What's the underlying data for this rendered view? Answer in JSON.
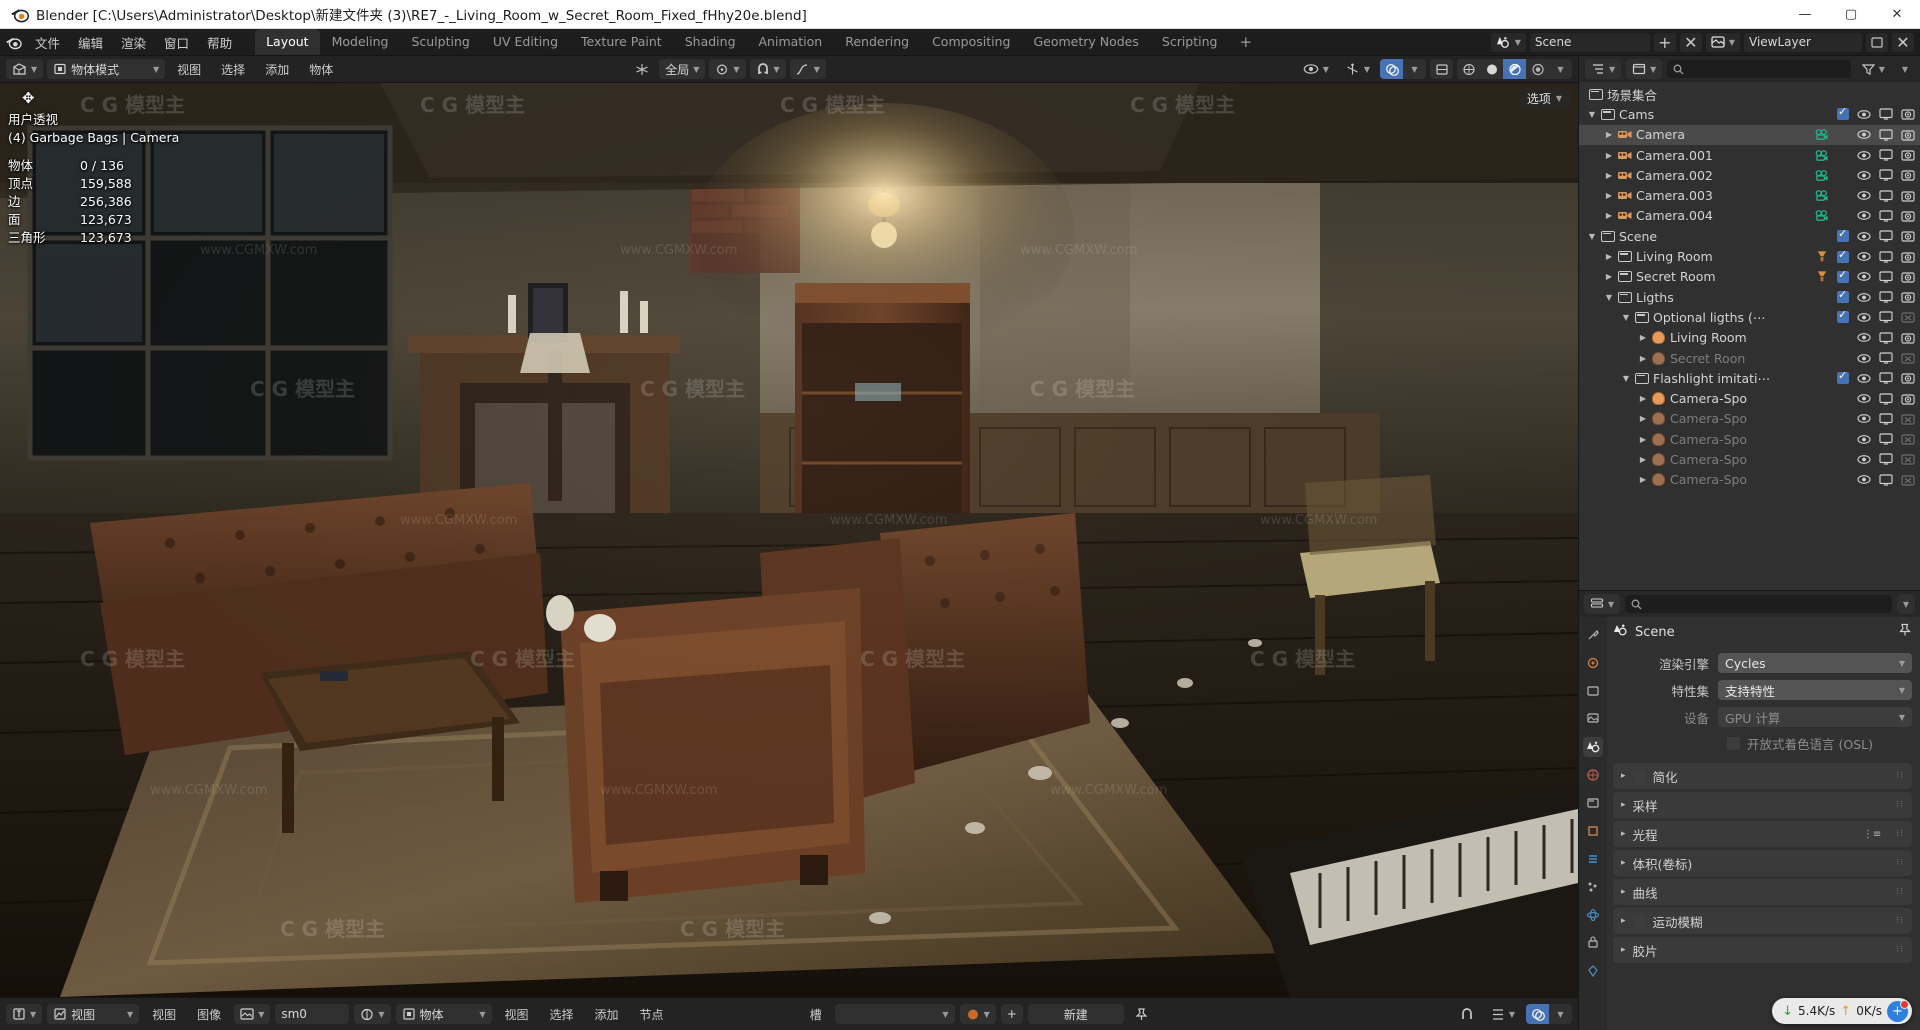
{
  "window": {
    "title": "Blender [C:\\Users\\Administrator\\Desktop\\新建文件夹 (3)\\RE7_-_Living_Room_w_Secret_Room_Fixed_fHhy20e.blend]",
    "minimize": "—",
    "maximize": "▢",
    "close": "✕"
  },
  "topbar": {
    "menus": [
      "文件",
      "编辑",
      "渲染",
      "窗口",
      "帮助"
    ],
    "workspaces": [
      "Layout",
      "Modeling",
      "Sculpting",
      "UV Editing",
      "Texture Paint",
      "Shading",
      "Animation",
      "Rendering",
      "Compositing",
      "Geometry Nodes",
      "Scripting"
    ],
    "active_workspace": "Layout",
    "add_workspace": "+",
    "scene_name": "Scene",
    "viewlayer_name": "ViewLayer",
    "scene_icon": "scene-icon",
    "viewlayer_icon": "viewlayer-icon"
  },
  "viewport_header": {
    "editor_type_icon": "editor-type-3dview-icon",
    "mode": "物体模式",
    "menus": [
      "视图",
      "选择",
      "添加",
      "物体"
    ],
    "transform_orientation": "全局",
    "snap_icon": "magnet-icon",
    "proportional_icon": "proportional-edit-icon",
    "pivot_icon": "pivot-icon",
    "visibility_icon": "eye-icon",
    "gizmo_icon": "gizmo-icon",
    "overlay_icon": "overlays-icon",
    "xray_icon": "xray-icon",
    "shading_modes": [
      "wireframe",
      "solid",
      "material-preview",
      "rendered"
    ],
    "active_shading": "rendered"
  },
  "viewport": {
    "cursor_icon": "move-cursor-icon",
    "view_name": "用户透视",
    "active_object": "(4) Garbage Bags | Camera",
    "stats": [
      {
        "label": "物体",
        "value": "0 / 136"
      },
      {
        "label": "顶点",
        "value": "159,588"
      },
      {
        "label": "边",
        "value": "256,386"
      },
      {
        "label": "面",
        "value": "123,673"
      },
      {
        "label": "三角形",
        "value": "123,673"
      }
    ],
    "options_label": "选项",
    "watermarks": [
      "CG模型主",
      "www.CGMXW.com"
    ]
  },
  "viewport_footer": {
    "left_editor_icon": "uv-editor-icon",
    "left_items": [
      "视图",
      "视图",
      "图像"
    ],
    "image_datablock_icon": "image-icon",
    "image_name": "sm0",
    "node_editor_icon": "node-editor-icon",
    "node_context": "物体",
    "node_menus": [
      "视图",
      "选择",
      "添加",
      "节点"
    ],
    "slot_label": "槽",
    "material_icon": "material-icon",
    "new_button": "新建",
    "pin_icon": "pin-icon",
    "snap_icon": "snap-icon",
    "overlay_icon": "overlay-icon"
  },
  "outliner": {
    "display_mode_icon": "outliner-display-mode-icon",
    "search_placeholder": "",
    "filter_icon": "filter-icon",
    "root": "场景集合",
    "rows": [
      {
        "indent": 0,
        "tri": "▼",
        "icon": "collection-icon",
        "name": "Cams",
        "checkbox": true,
        "eye": true,
        "screen": true,
        "camera": true,
        "dim": false,
        "datatype": ""
      },
      {
        "indent": 1,
        "tri": "▶",
        "icon": "camera-data-icon",
        "name": "Camera",
        "checkbox": null,
        "eye": true,
        "screen": true,
        "camera": true,
        "dim": false,
        "datatype": "camera-green",
        "selected": true
      },
      {
        "indent": 1,
        "tri": "▶",
        "icon": "camera-data-icon",
        "name": "Camera.001",
        "checkbox": null,
        "eye": true,
        "screen": true,
        "camera": true,
        "dim": false,
        "datatype": "camera-green"
      },
      {
        "indent": 1,
        "tri": "▶",
        "icon": "camera-data-icon",
        "name": "Camera.002",
        "checkbox": null,
        "eye": true,
        "screen": true,
        "camera": true,
        "dim": false,
        "datatype": "camera-green"
      },
      {
        "indent": 1,
        "tri": "▶",
        "icon": "camera-data-icon",
        "name": "Camera.003",
        "checkbox": null,
        "eye": true,
        "screen": true,
        "camera": true,
        "dim": false,
        "datatype": "camera-green"
      },
      {
        "indent": 1,
        "tri": "▶",
        "icon": "camera-data-icon",
        "name": "Camera.004",
        "checkbox": null,
        "eye": true,
        "screen": true,
        "camera": true,
        "dim": false,
        "datatype": "camera-green"
      },
      {
        "indent": 0,
        "tri": "▼",
        "icon": "collection-icon",
        "name": "Scene",
        "checkbox": true,
        "eye": true,
        "screen": true,
        "camera": true,
        "dim": false,
        "datatype": ""
      },
      {
        "indent": 1,
        "tri": "▶",
        "icon": "collection-icon",
        "name": "Living Room",
        "checkbox": true,
        "eye": true,
        "screen": true,
        "camera": true,
        "dim": false,
        "datatype": "light-count"
      },
      {
        "indent": 1,
        "tri": "▶",
        "icon": "collection-icon",
        "name": "Secret Room",
        "checkbox": true,
        "eye": true,
        "screen": true,
        "camera": true,
        "dim": false,
        "datatype": "light-count"
      },
      {
        "indent": 1,
        "tri": "▼",
        "icon": "collection-icon",
        "name": "Ligths",
        "checkbox": true,
        "eye": true,
        "screen": true,
        "camera": true,
        "dim": false,
        "datatype": ""
      },
      {
        "indent": 2,
        "tri": "▼",
        "icon": "collection-icon",
        "name": "Optional ligths (⋯",
        "checkbox": true,
        "eye": true,
        "screen": true,
        "camera": false,
        "dim": false,
        "datatype": ""
      },
      {
        "indent": 3,
        "tri": "▶",
        "icon": "light-icon",
        "name": "Living Room",
        "checkbox": null,
        "eye": true,
        "screen": true,
        "camera": true,
        "dim": false,
        "datatype": ""
      },
      {
        "indent": 3,
        "tri": "▶",
        "icon": "light-icon-dim",
        "name": "Secret Roon",
        "checkbox": null,
        "eye": true,
        "screen": true,
        "camera": false,
        "dim": true,
        "datatype": ""
      },
      {
        "indent": 2,
        "tri": "▼",
        "icon": "collection-icon",
        "name": "Flashlight imitati⋯",
        "checkbox": true,
        "eye": true,
        "screen": true,
        "camera": true,
        "dim": false,
        "datatype": ""
      },
      {
        "indent": 3,
        "tri": "▶",
        "icon": "light-icon",
        "name": "Camera-Spo",
        "checkbox": null,
        "eye": true,
        "screen": true,
        "camera": true,
        "dim": false,
        "datatype": ""
      },
      {
        "indent": 3,
        "tri": "▶",
        "icon": "light-icon-dim",
        "name": "Camera-Spo",
        "checkbox": null,
        "eye": true,
        "screen": true,
        "camera": false,
        "dim": true,
        "datatype": ""
      },
      {
        "indent": 3,
        "tri": "▶",
        "icon": "light-icon-dim",
        "name": "Camera-Spo",
        "checkbox": null,
        "eye": true,
        "screen": true,
        "camera": false,
        "dim": true,
        "datatype": ""
      },
      {
        "indent": 3,
        "tri": "▶",
        "icon": "light-icon-dim",
        "name": "Camera-Spo",
        "checkbox": null,
        "eye": true,
        "screen": true,
        "camera": false,
        "dim": true,
        "datatype": ""
      },
      {
        "indent": 3,
        "tri": "▶",
        "icon": "light-icon-dim",
        "name": "Camera-Spo",
        "checkbox": null,
        "eye": true,
        "screen": true,
        "camera": false,
        "dim": true,
        "datatype": ""
      }
    ]
  },
  "properties": {
    "editor_icon": "properties-editor-icon",
    "search_placeholder": "",
    "breadcrumb": "Scene",
    "breadcrumb_icon": "scene-icon",
    "pin_icon": "pin-icon",
    "tabs": [
      "tool-icon",
      "render-icon",
      "output-icon",
      "viewlayer-icon",
      "scene-icon",
      "world-icon",
      "collection-icon",
      "object-icon",
      "modifier-icon",
      "particles-icon",
      "physics-icon",
      "constraint-icon",
      "data-icon"
    ],
    "active_tab_index": 4,
    "fields": [
      {
        "label": "渲染引擎",
        "value": "Cycles",
        "dim": false,
        "dropdown": true
      },
      {
        "label": "特性集",
        "value": "支持特性",
        "dim": false,
        "dropdown": true
      },
      {
        "label": "设备",
        "value": "GPU 计算",
        "dim": true,
        "dropdown": true
      }
    ],
    "osl_label": "开放式着色语言 (OSL)",
    "osl_checked": false,
    "panels": [
      {
        "label": "简化",
        "checkbox": true,
        "extra": false
      },
      {
        "label": "采样",
        "checkbox": false,
        "extra": false
      },
      {
        "label": "光程",
        "checkbox": false,
        "extra": true
      },
      {
        "label": "体积(卷标)",
        "checkbox": false,
        "extra": false
      },
      {
        "label": "曲线",
        "checkbox": false,
        "extra": false
      },
      {
        "label": "运动模糊",
        "checkbox": true,
        "extra": false
      },
      {
        "label": "胶片",
        "checkbox": false,
        "extra": false
      }
    ]
  },
  "net_popup": {
    "down_speed": "5.4K/s",
    "up_speed": "0K/s",
    "down_icon": "arrow-down-icon",
    "up_icon": "arrow-up-icon",
    "badge_icon": "add-bubble-icon"
  }
}
